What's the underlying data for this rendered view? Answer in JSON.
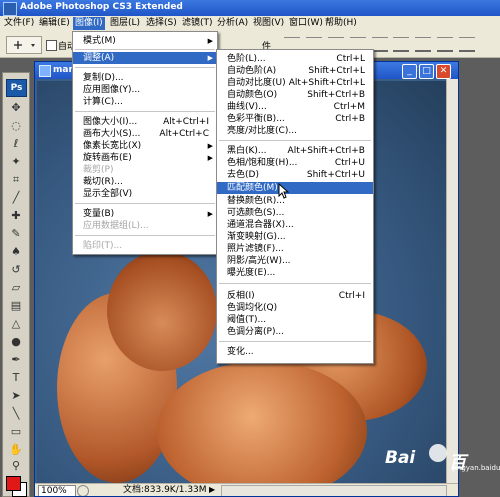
{
  "window": {
    "title": "Adobe Photoshop CS3 Extended"
  },
  "menubar": {
    "items": [
      "文件(F)",
      "编辑(E)",
      "图像(I)",
      "图层(L)",
      "选择(S)",
      "滤镜(T)",
      "分析(A)",
      "视图(V)",
      "窗口(W)",
      "帮助(H)"
    ],
    "active": "图像(I)"
  },
  "options_bar": {
    "auto_select_label": "自动",
    "partial_text": "件"
  },
  "document": {
    "title": "mar",
    "zoom": "100%",
    "doc_info": "文档:833.9K/1.33M"
  },
  "image_menu": {
    "items": [
      {
        "label": "模式(M)",
        "shortcut": "",
        "submenu": true,
        "disabled": false
      },
      {
        "label": "调整(A)",
        "shortcut": "",
        "submenu": true,
        "disabled": false,
        "highlighted": true
      },
      {
        "label": "复制(D)...",
        "shortcut": "",
        "submenu": false,
        "disabled": false
      },
      {
        "label": "应用图像(Y)...",
        "shortcut": "",
        "submenu": false,
        "disabled": false
      },
      {
        "label": "计算(C)...",
        "shortcut": "",
        "submenu": false,
        "disabled": false
      },
      {
        "label": "图像大小(I)...",
        "shortcut": "Alt+Ctrl+I",
        "submenu": false,
        "disabled": false
      },
      {
        "label": "画布大小(S)...",
        "shortcut": "Alt+Ctrl+C",
        "submenu": false,
        "disabled": false
      },
      {
        "label": "像素长宽比(X)",
        "shortcut": "",
        "submenu": true,
        "disabled": false
      },
      {
        "label": "旋转画布(E)",
        "shortcut": "",
        "submenu": true,
        "disabled": false
      },
      {
        "label": "裁剪(P)",
        "shortcut": "",
        "submenu": false,
        "disabled": true
      },
      {
        "label": "裁切(R)...",
        "shortcut": "",
        "submenu": false,
        "disabled": false
      },
      {
        "label": "显示全部(V)",
        "shortcut": "",
        "submenu": false,
        "disabled": false
      },
      {
        "label": "变量(B)",
        "shortcut": "",
        "submenu": true,
        "disabled": false
      },
      {
        "label": "应用数据组(L)...",
        "shortcut": "",
        "submenu": false,
        "disabled": true
      },
      {
        "label": "陷印(T)...",
        "shortcut": "",
        "submenu": false,
        "disabled": true
      }
    ]
  },
  "adjust_menu": {
    "items": [
      {
        "label": "色阶(L)...",
        "shortcut": "Ctrl+L"
      },
      {
        "label": "自动色阶(A)",
        "shortcut": "Shift+Ctrl+L"
      },
      {
        "label": "自动对比度(U)",
        "shortcut": "Alt+Shift+Ctrl+L"
      },
      {
        "label": "自动颜色(O)",
        "shortcut": "Shift+Ctrl+B"
      },
      {
        "label": "曲线(V)...",
        "shortcut": "Ctrl+M"
      },
      {
        "label": "色彩平衡(B)...",
        "shortcut": "Ctrl+B"
      },
      {
        "label": "亮度/对比度(C)...",
        "shortcut": ""
      },
      {
        "label": "黑白(K)...",
        "shortcut": "Alt+Shift+Ctrl+B"
      },
      {
        "label": "色相/饱和度(H)...",
        "shortcut": "Ctrl+U"
      },
      {
        "label": "去色(D)",
        "shortcut": "Shift+Ctrl+U"
      },
      {
        "label": "匹配颜色(M)...",
        "shortcut": "",
        "highlighted": true
      },
      {
        "label": "替换颜色(R)...",
        "shortcut": ""
      },
      {
        "label": "可选颜色(S)...",
        "shortcut": ""
      },
      {
        "label": "通道混合器(X)...",
        "shortcut": ""
      },
      {
        "label": "渐变映射(G)...",
        "shortcut": ""
      },
      {
        "label": "照片滤镜(F)...",
        "shortcut": ""
      },
      {
        "label": "阴影/高光(W)...",
        "shortcut": ""
      },
      {
        "label": "曝光度(E)...",
        "shortcut": ""
      },
      {
        "label": "反相(I)",
        "shortcut": "Ctrl+I"
      },
      {
        "label": "色调均化(Q)",
        "shortcut": ""
      },
      {
        "label": "阈值(T)...",
        "shortcut": ""
      },
      {
        "label": "色调分离(P)...",
        "shortcut": ""
      },
      {
        "label": "变化...",
        "shortcut": ""
      }
    ]
  },
  "toolbox": {
    "logo": "Ps",
    "foreground_color": "#e01818",
    "background_color": "#ffffff"
  },
  "watermark": {
    "text_left": "Bai",
    "text_right": "百",
    "sub": "jingyan.baidu.com"
  }
}
